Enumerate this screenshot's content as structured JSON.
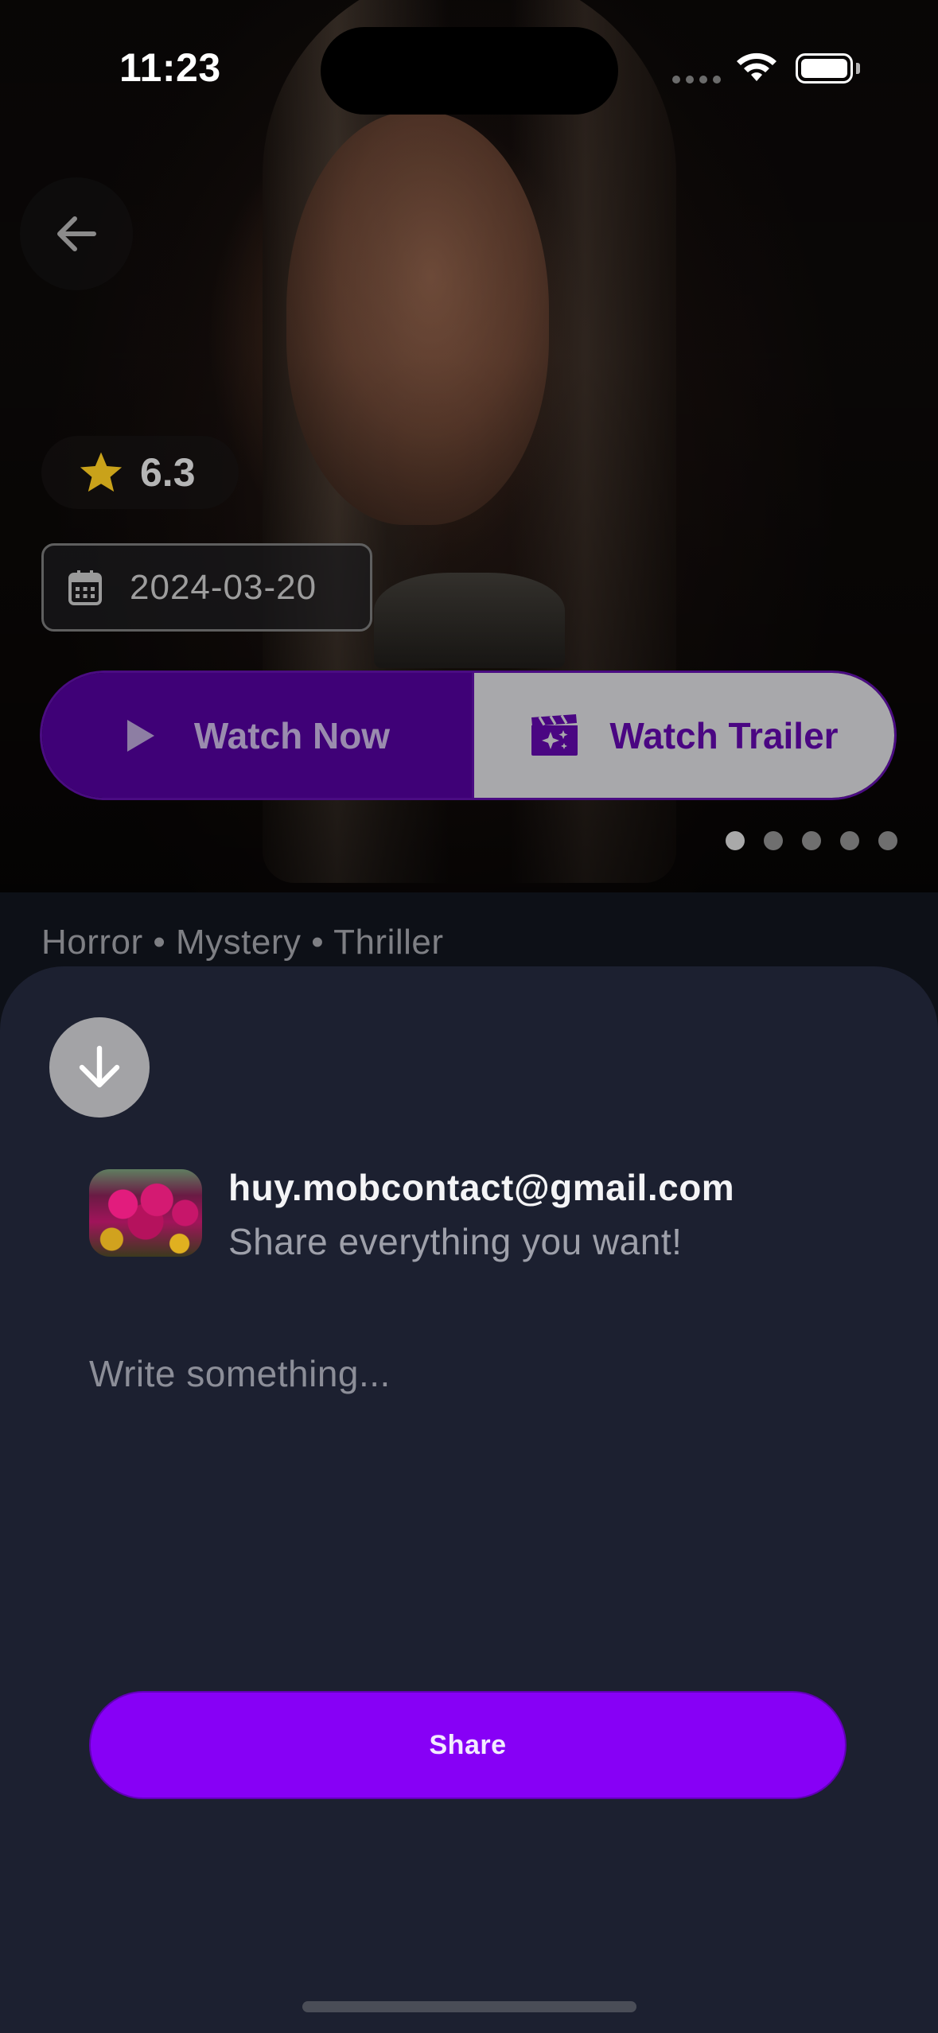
{
  "status_bar": {
    "time": "11:23"
  },
  "hero": {
    "back_icon": "arrow-left-icon",
    "rating": {
      "icon": "star-icon",
      "value": "6.3"
    },
    "release_date": {
      "icon": "calendar-icon",
      "value": "2024-03-20"
    },
    "actions": {
      "watch_now_label": "Watch Now",
      "watch_trailer_label": "Watch Trailer"
    },
    "carousel": {
      "page_count": 5,
      "active_index": 0
    },
    "genres": "Horror • Mystery • Thriller"
  },
  "share_sheet": {
    "collapse_icon": "arrow-down-icon",
    "user": {
      "email": "huy.mobcontact@gmail.com",
      "tagline": "Share everything you want!"
    },
    "composer": {
      "placeholder": "Write something...",
      "value": ""
    },
    "share_label": "Share"
  },
  "colors": {
    "accent": "#8700f6",
    "watch_now_bg": "#3f0177",
    "sheet_bg": "#1c2030",
    "star": "#c9a21a"
  }
}
